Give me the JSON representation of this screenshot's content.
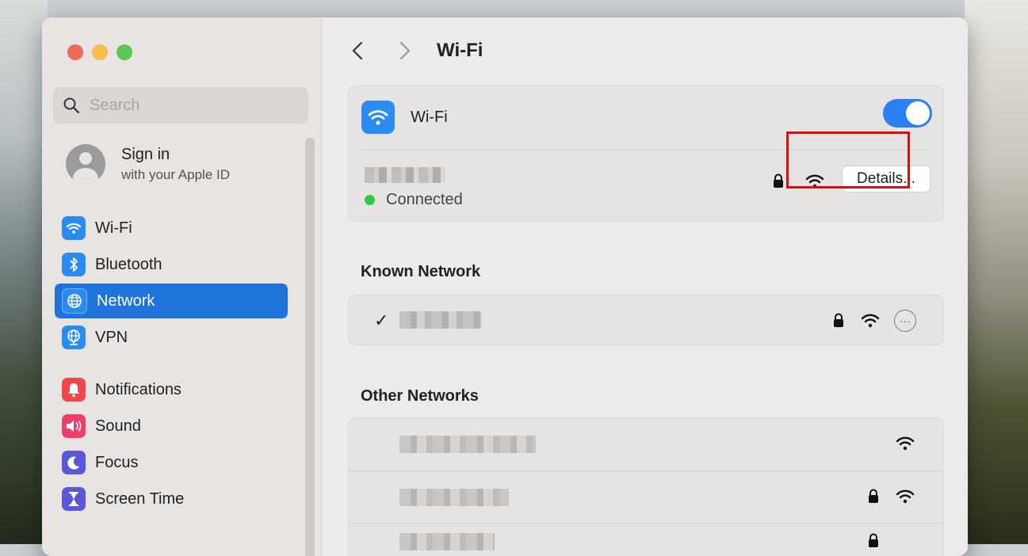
{
  "window": {
    "traffic_lights": [
      "close",
      "minimize",
      "zoom"
    ]
  },
  "sidebar": {
    "search": {
      "placeholder": "Search",
      "value": ""
    },
    "account": {
      "title": "Sign in",
      "subtitle": "with your Apple ID"
    },
    "items": [
      {
        "label": "Wi-Fi",
        "icon": "wifi-icon",
        "color": "#2b8cf0",
        "selected": false
      },
      {
        "label": "Bluetooth",
        "icon": "bluetooth-icon",
        "color": "#2b8cf0",
        "selected": false
      },
      {
        "label": "Network",
        "icon": "globe-icon",
        "color": "#2b8cf0",
        "selected": true
      },
      {
        "label": "VPN",
        "icon": "vpn-globe-icon",
        "color": "#2b8cf0",
        "selected": false
      },
      {
        "label": "Notifications",
        "icon": "bell-icon",
        "color": "#f0474b",
        "selected": false
      },
      {
        "label": "Sound",
        "icon": "speaker-icon",
        "color": "#ee3f6b",
        "selected": false
      },
      {
        "label": "Focus",
        "icon": "moon-icon",
        "color": "#5b57d6",
        "selected": false
      },
      {
        "label": "Screen Time",
        "icon": "hourglass-icon",
        "color": "#5b57d6",
        "selected": false
      }
    ]
  },
  "main": {
    "title": "Wi-Fi",
    "wifi_card": {
      "label": "Wi-Fi",
      "toggle_on": true,
      "current_network": {
        "status": "Connected",
        "details_label": "Details...",
        "secured": true
      }
    },
    "known_section": {
      "title": "Known Network",
      "networks": [
        {
          "checked": true,
          "secured": true
        }
      ]
    },
    "other_section": {
      "title": "Other Networks",
      "networks": [
        {
          "secured": false
        },
        {
          "secured": true
        },
        {
          "secured": true
        }
      ]
    }
  },
  "colors": {
    "accent": "#1f73db",
    "toggle": "#2d7ff5",
    "connected": "#33c748",
    "highlight": "#e20b0b"
  }
}
